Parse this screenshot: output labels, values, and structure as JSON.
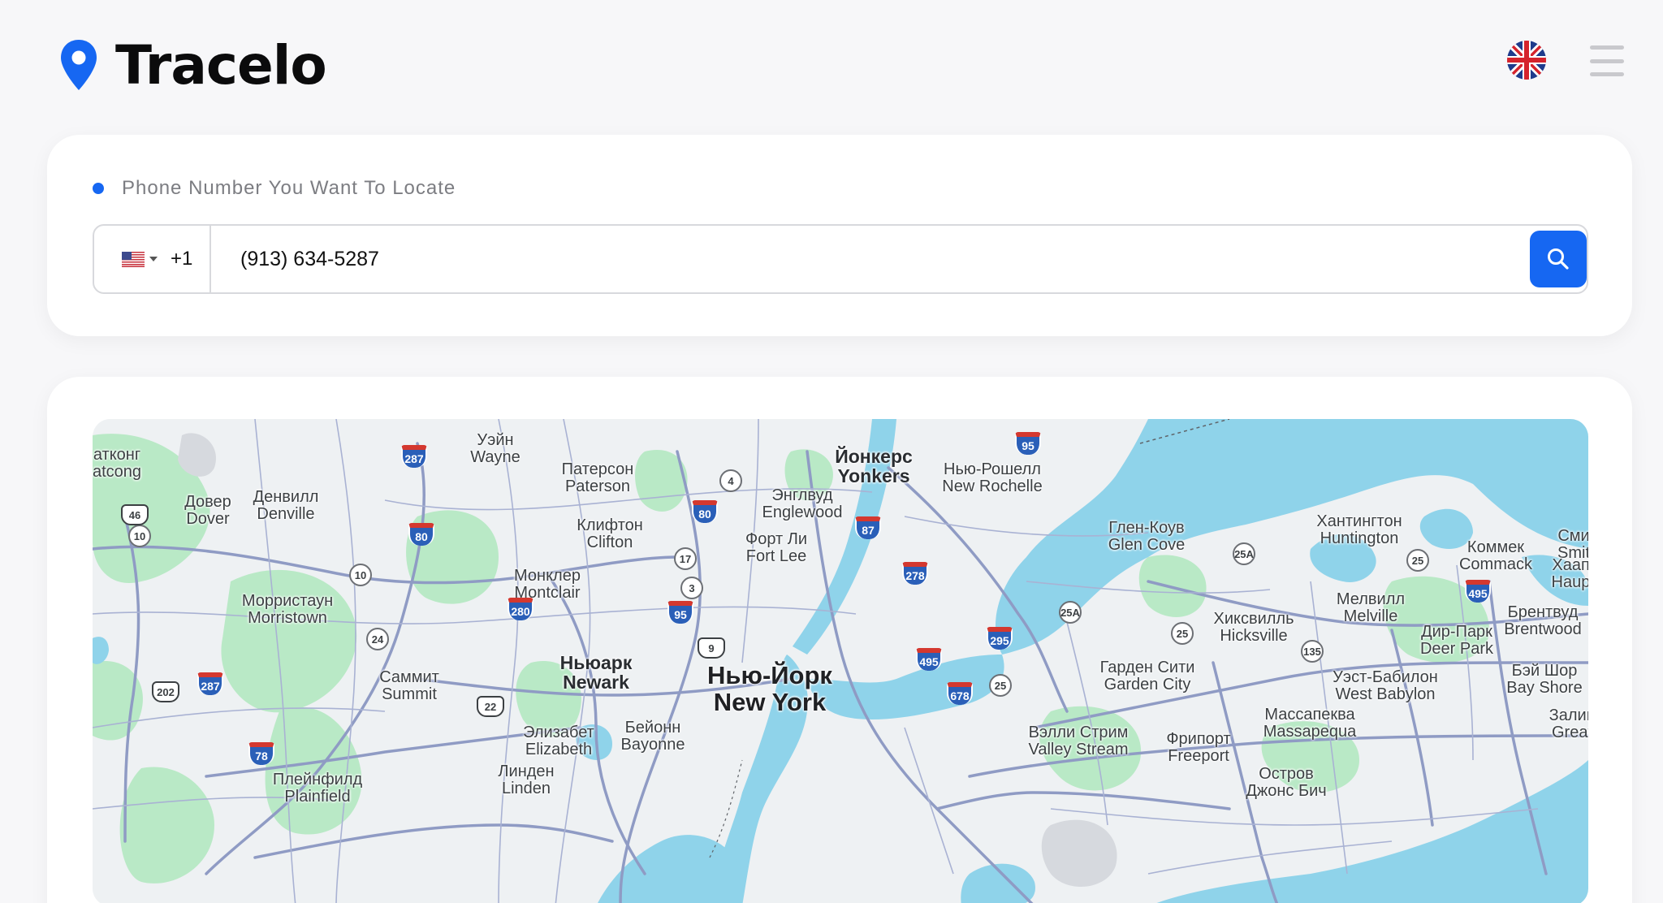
{
  "header": {
    "brand": "Tracelo",
    "language_flag_icon": "uk-flag-icon",
    "menu_icon": "hamburger-menu-icon"
  },
  "search": {
    "label": "Phone Number You Want To Locate",
    "country_flag_icon": "us-flag-icon",
    "dial_code": "+1",
    "phone_value": "(913) 634-5287",
    "search_icon": "search-icon"
  },
  "colors": {
    "accent": "#1667f2",
    "water": "#8fd3ea",
    "park": "#9fe0b6",
    "road": "#8f9bc4"
  },
  "map": {
    "places": [
      {
        "id": "newyork",
        "ru": "Нью-Йорк",
        "en": "New York",
        "size": "l"
      },
      {
        "id": "newark",
        "ru": "Ньюарк",
        "en": "Newark",
        "size": "m"
      },
      {
        "id": "yonkers",
        "ru": "Йонкерс",
        "en": "Yonkers",
        "size": "m"
      },
      {
        "id": "paterson",
        "ru": "Патерсон",
        "en": "Paterson",
        "size": "s"
      },
      {
        "id": "wayne",
        "ru": "Уэйн",
        "en": "Wayne",
        "size": "s"
      },
      {
        "id": "clifton",
        "ru": "Клифтон",
        "en": "Clifton",
        "size": "s"
      },
      {
        "id": "montclair",
        "ru": "Монклер",
        "en": "Montclair",
        "size": "s"
      },
      {
        "id": "englewood",
        "ru": "Энглвуд",
        "en": "Englewood",
        "size": "s"
      },
      {
        "id": "fortlee",
        "ru": "Форт Ли",
        "en": "Fort Lee",
        "size": "s"
      },
      {
        "id": "newrochelle",
        "ru": "Нью-Рошелл",
        "en": "New Rochelle",
        "size": "s"
      },
      {
        "id": "dover",
        "ru": "Довер",
        "en": "Dover",
        "size": "s"
      },
      {
        "id": "denville",
        "ru": "Денвилл",
        "en": "Denville",
        "size": "s"
      },
      {
        "id": "hatcong",
        "ru": "атконг",
        "en": "atcong",
        "size": "s"
      },
      {
        "id": "morristown",
        "ru": "Морристаун",
        "en": "Morristown",
        "size": "s"
      },
      {
        "id": "summit",
        "ru": "Саммит",
        "en": "Summit",
        "size": "s"
      },
      {
        "id": "elizabeth",
        "ru": "Элизабет",
        "en": "Elizabeth",
        "size": "s"
      },
      {
        "id": "bayonne",
        "ru": "Бейонн",
        "en": "Bayonne",
        "size": "s"
      },
      {
        "id": "linden",
        "ru": "Линден",
        "en": "Linden",
        "size": "s"
      },
      {
        "id": "plainfield",
        "ru": "Плейнфилд",
        "en": "Plainfield",
        "size": "s"
      },
      {
        "id": "glencove",
        "ru": "Глен-Коув",
        "en": "Glen Cove",
        "size": "s"
      },
      {
        "id": "huntington",
        "ru": "Хантингтон",
        "en": "Huntington",
        "size": "s"
      },
      {
        "id": "commack",
        "ru": "Коммек",
        "en": "Commack",
        "size": "s"
      },
      {
        "id": "smithtown",
        "ru": "Сми",
        "en": "Smit",
        "size": "s"
      },
      {
        "id": "hauppauge",
        "ru": "Хаапп",
        "en": "Haupp",
        "size": "s"
      },
      {
        "id": "melville",
        "ru": "Мелвилл",
        "en": "Melville",
        "size": "s"
      },
      {
        "id": "hicksville",
        "ru": "Хиксвилль",
        "en": "Hicksville",
        "size": "s"
      },
      {
        "id": "brentwood",
        "ru": "Брентвуд",
        "en": "Brentwood",
        "size": "s"
      },
      {
        "id": "deerpark",
        "ru": "Дир-Парк",
        "en": "Deer Park",
        "size": "s"
      },
      {
        "id": "gardencity",
        "ru": "Гарден Сити",
        "en": "Garden City",
        "size": "s"
      },
      {
        "id": "westbabylon",
        "ru": "Уэст-Бабилон",
        "en": "West Babylon",
        "size": "s"
      },
      {
        "id": "bayshore",
        "ru": "Бэй Шор",
        "en": "Bay Shore",
        "size": "s"
      },
      {
        "id": "massapequa",
        "ru": "Массапеква",
        "en": "Massapequa",
        "size": "s"
      },
      {
        "id": "valleystream",
        "ru": "Вэлли Стрим",
        "en": "Valley Stream",
        "size": "s"
      },
      {
        "id": "freeport",
        "ru": "Фрипорт",
        "en": "Freeport",
        "size": "s"
      },
      {
        "id": "jonesbeach",
        "ru": "Остров",
        "en": "Джонс Бич",
        "size": "s"
      },
      {
        "id": "greatsouthbay",
        "ru": "Залив",
        "en": "Great",
        "size": "s"
      }
    ],
    "shields": [
      {
        "id": "i287a",
        "text": "287",
        "type": "i"
      },
      {
        "id": "i287b",
        "text": "287",
        "type": "i"
      },
      {
        "id": "i80a",
        "text": "80",
        "type": "i"
      },
      {
        "id": "i80b",
        "text": "80",
        "type": "i"
      },
      {
        "id": "i95a",
        "text": "95",
        "type": "i"
      },
      {
        "id": "i95b",
        "text": "95",
        "type": "i"
      },
      {
        "id": "i87",
        "text": "87",
        "type": "i"
      },
      {
        "id": "i278",
        "text": "278",
        "type": "i"
      },
      {
        "id": "i280",
        "text": "280",
        "type": "i"
      },
      {
        "id": "i295",
        "text": "295",
        "type": "i"
      },
      {
        "id": "i495a",
        "text": "495",
        "type": "i"
      },
      {
        "id": "i495b",
        "text": "495",
        "type": "i"
      },
      {
        "id": "i678",
        "text": "678",
        "type": "i"
      },
      {
        "id": "i78",
        "text": "78",
        "type": "i"
      },
      {
        "id": "s4",
        "text": "4",
        "type": "s"
      },
      {
        "id": "s17",
        "text": "17",
        "type": "s"
      },
      {
        "id": "s3",
        "text": "3",
        "type": "s"
      },
      {
        "id": "s10a",
        "text": "10",
        "type": "s"
      },
      {
        "id": "s10b",
        "text": "10",
        "type": "s"
      },
      {
        "id": "s24",
        "text": "24",
        "type": "s"
      },
      {
        "id": "s25a",
        "text": "25A",
        "type": "s"
      },
      {
        "id": "s25b",
        "text": "25A",
        "type": "s"
      },
      {
        "id": "s25",
        "text": "25",
        "type": "s"
      },
      {
        "id": "s25c",
        "text": "25",
        "type": "s"
      },
      {
        "id": "s25d",
        "text": "25",
        "type": "s"
      },
      {
        "id": "s135",
        "text": "135",
        "type": "s"
      },
      {
        "id": "u46",
        "text": "46",
        "type": "u"
      },
      {
        "id": "u9",
        "text": "9",
        "type": "u"
      },
      {
        "id": "u22",
        "text": "22",
        "type": "u"
      },
      {
        "id": "u202",
        "text": "202",
        "type": "u"
      }
    ]
  }
}
